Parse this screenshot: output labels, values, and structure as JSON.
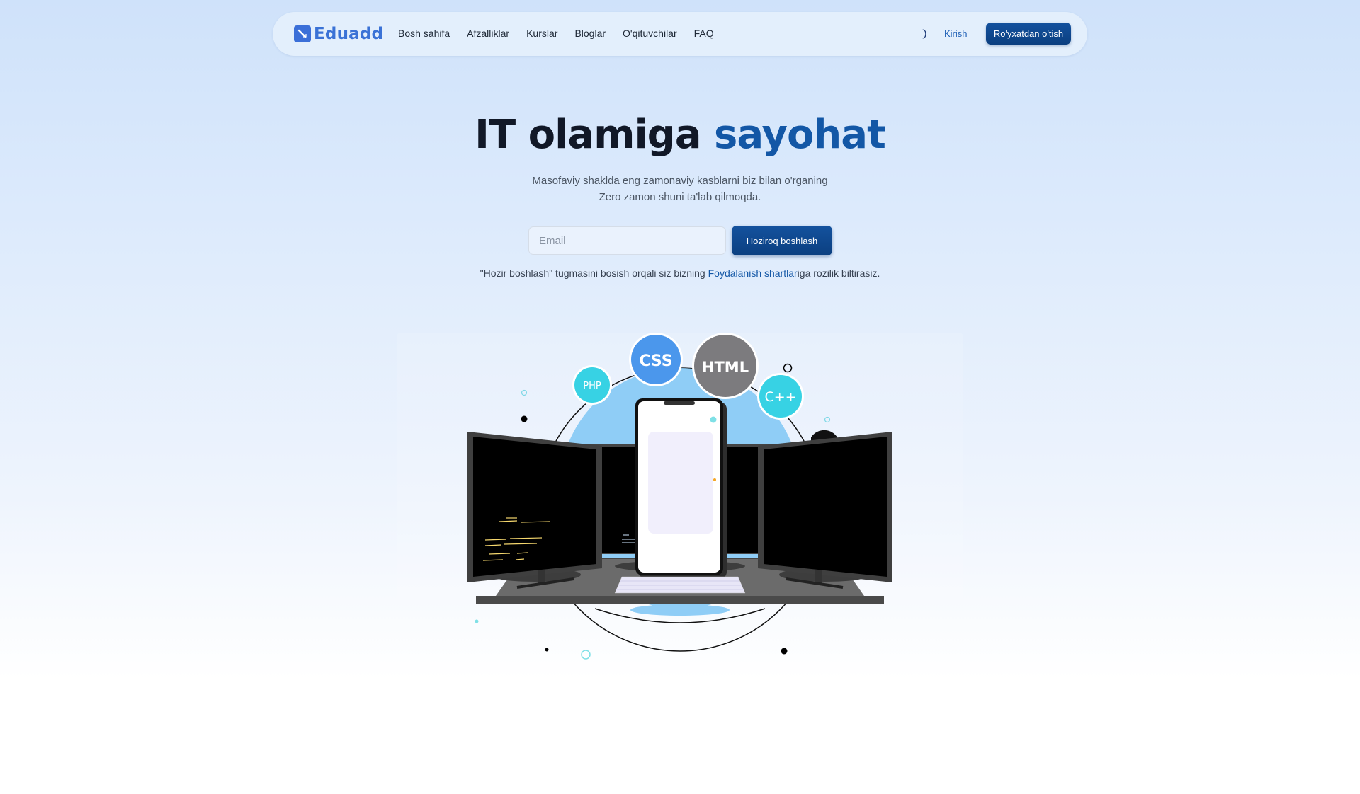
{
  "brand": {
    "name": "Eduadd",
    "accent": "#3a72d6",
    "primary": "#0f4a92"
  },
  "nav": {
    "links": [
      "Bosh sahifa",
      "Afzalliklar",
      "Kurslar",
      "Bloglar",
      "O'qituvchilar",
      "FAQ"
    ],
    "theme_icon": "moon-icon",
    "login_label": "Kirish",
    "register_label": "Ro'yxatdan o'tish"
  },
  "hero": {
    "title_main": "IT olamiga ",
    "title_accent": "sayohat",
    "subtitle_line1": "Masofaviy shaklda eng zamonaviy kasblarni biz bilan o'rganing",
    "subtitle_line2": "Zero zamon shuni ta'lab qilmoqda.",
    "email_placeholder": "Email",
    "start_label": "Hoziroq boshlash",
    "terms_before": "\"Hozir boshlash\" tugmasini bosish orqali siz bizning ",
    "terms_link": "Foydalanish shartlar",
    "terms_after": "iga rozilik biltirasiz."
  },
  "illustration": {
    "bubbles": [
      "CSS",
      "HTML",
      "PHP",
      "C++"
    ]
  }
}
